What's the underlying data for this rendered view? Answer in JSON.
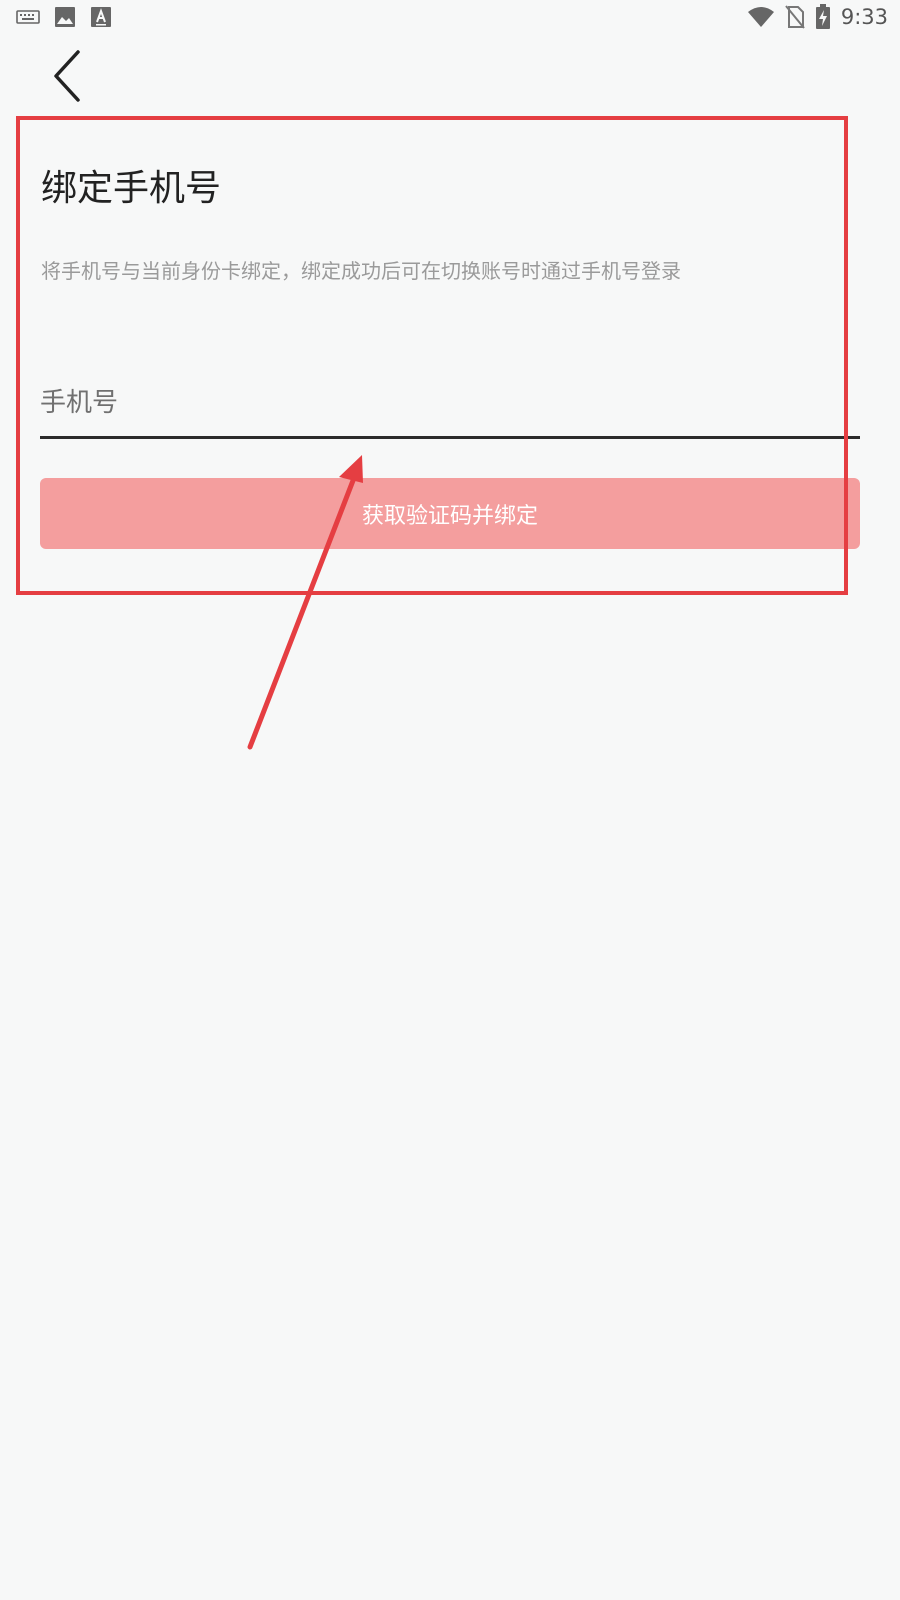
{
  "status_bar": {
    "time": "9:33",
    "left_icons": [
      "keyboard-icon",
      "image-icon",
      "font-download-icon"
    ],
    "right_icons": [
      "wifi-icon",
      "no-sim-icon",
      "battery-charging-icon"
    ]
  },
  "nav": {
    "back_icon": "chevron-left-icon"
  },
  "page": {
    "title": "绑定手机号",
    "description": "将手机号与当前身份卡绑定，绑定成功后可在切换账号时通过手机号登录"
  },
  "form": {
    "phone_placeholder": "手机号",
    "phone_value": "",
    "submit_label": "获取验证码并绑定"
  },
  "colors": {
    "background": "#f7f8f8",
    "button_bg": "#f49e9e",
    "annotation": "#e53e42",
    "input_underline": "#2b2b2b"
  }
}
